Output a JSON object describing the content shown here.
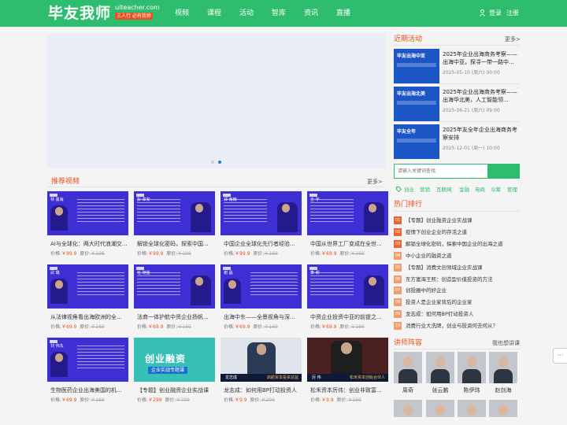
{
  "header": {
    "logo": "毕友我师",
    "logo_domain": "uiteacher.com",
    "logo_tag": "三人行 必有我师",
    "nav": [
      "视频",
      "课程",
      "活动",
      "智库",
      "资讯",
      "直播"
    ],
    "login": "登录",
    "register": "注册"
  },
  "colors": {
    "brand": "#2ebd6e",
    "accent": "#e8501c",
    "card_blue": "#3d2fd3"
  },
  "banner": {
    "active_dot": 2
  },
  "videos": {
    "title": "推荐视频",
    "more": "更多>",
    "price_label": "价格:",
    "orig_label": "原价:",
    "cards": [
      {
        "title": "AI与全球化：两大时代浪潮交...",
        "price": "￥99.9",
        "orig": "￥198",
        "name": "林 童海"
      },
      {
        "title": "解锁全球化密码，探索中国...",
        "price": "￥99.9",
        "orig": "￥198",
        "name": "彭 章安"
      },
      {
        "title": "中国企业全球化先行者经验...",
        "price": "￥99.9",
        "orig": "￥169",
        "name": "郑 南楠"
      },
      {
        "title": "中国从世界工厂变成在全世...",
        "price": "￥69.9",
        "orig": "￥169",
        "name": "王 宇"
      },
      {
        "title": "从法律视角看出海欧洲的全...",
        "price": "￥69.9",
        "orig": "￥169",
        "name": "武 璐"
      },
      {
        "title": "法商一体护航中资企业扬帆...",
        "price": "￥69.9",
        "orig": "￥169",
        "name": "杜 铠金"
      },
      {
        "title": "出海中东——全景视角与深...",
        "price": "￥69.9",
        "orig": "￥169",
        "name": "谢 晶"
      },
      {
        "title": "中资企业投资中亚的前提之...",
        "price": "￥69.9",
        "orig": "￥169",
        "name": "李 莉"
      },
      {
        "title": "生物医药企业出海美国的机...",
        "price": "￥69.9",
        "orig": "￥169",
        "name": "刘 伟东"
      },
      {
        "title": "【专题】创业融资企业实战课",
        "price": "￥299",
        "orig": "￥799",
        "overlay1": "创业融资",
        "overlay2": "企业实战专题课"
      },
      {
        "title": "龙志成：如何用BP打动投资人",
        "price": "￥9.9",
        "orig": "￥299",
        "overlay_name": "龙志成",
        "overlay_sub": "启航资本投资总监"
      },
      {
        "title": "松禾资本厉伟：创业非致富...",
        "price": "￥9.9",
        "orig": "￥169",
        "overlay_name": "厉 伟",
        "overlay_sub": "松禾资本创始合伙人"
      }
    ]
  },
  "events": {
    "title": "近期活动",
    "more": "更多>",
    "items": [
      {
        "title": "2025年企业出海商务考察——出海中亚，探寻一带一路中...",
        "date": "2025-05-10  (周六)  00:00",
        "img_text": "毕友出海中亚"
      },
      {
        "title": "2025年企业出海商务考察——出海华北美，人工智能领...",
        "date": "2025-06-21  (周六)  09:00",
        "img_text": "毕友出海北美"
      },
      {
        "title": "2025年友全年企业出海商务考察安排",
        "date": "2025-12-01  (周一)  10:00",
        "img_text": "毕友全年"
      }
    ]
  },
  "search": {
    "placeholder": "请输入关键词查找"
  },
  "tags": [
    "创业",
    "营销",
    "互联网",
    "金融",
    "电商",
    "众筹",
    "管理"
  ],
  "ranking": {
    "title": "热门排行",
    "items": [
      "【专题】创业融资企业实战课",
      "疫情下创业企业的存活之道",
      "解锁全球化密码，探索中国企业的出海之道",
      "中小企业的融资之道",
      "【专题】消费文创领域企业实战课",
      "东方富海王熙：创造型价值投资的方法",
      "创投圈中的好企业",
      "投资人是企业家背后的企业家",
      "龙志成：如何用BP打动投资人",
      "消费行业大洗牌，创业与投资何去何从？"
    ]
  },
  "teachers": {
    "title": "讲师阵容",
    "more": "我也想讲课",
    "items": [
      {
        "name": "周奇"
      },
      {
        "name": "张云鹏"
      },
      {
        "name": "陈伊玮"
      },
      {
        "name": "赵剑海"
      }
    ]
  },
  "float": {
    "chat": "···"
  }
}
